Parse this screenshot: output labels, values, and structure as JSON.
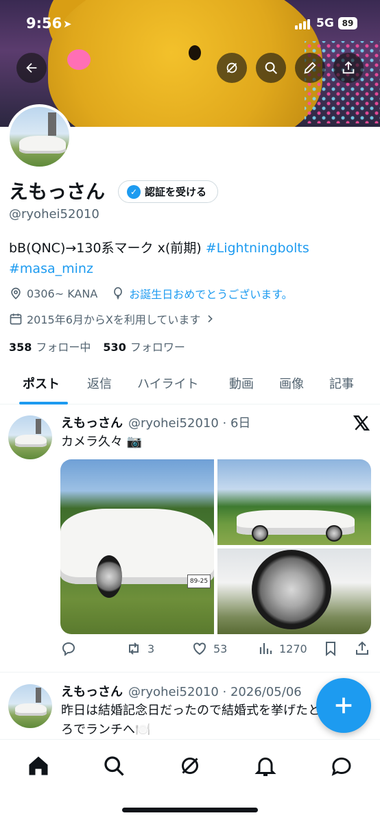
{
  "status_bar": {
    "time": "9:56",
    "network": "5G",
    "battery": "89"
  },
  "profile": {
    "name": "えもっさん",
    "verify_button": "認証を受ける",
    "handle": "@ryohei52010",
    "bio_text": "bB(QNC)→130系マーク x(前期) ",
    "bio_tag1": "#Lightningbolts",
    "bio_tag2": "#masa_minz",
    "location": "0306~  KANA",
    "birthday": "お誕生日おめでとうございます。",
    "joined": "2015年6月からXを利用しています",
    "following_count": "358",
    "following_label": "フォロー中",
    "followers_count": "530",
    "followers_label": "フォロワー"
  },
  "tabs": [
    "ポスト",
    "返信",
    "ハイライト",
    "動画",
    "画像",
    "記事"
  ],
  "posts": [
    {
      "name": "えもっさん",
      "meta": "@ryohei52010 · 6日",
      "text": "カメラ久々 📷",
      "plate": "89-25",
      "actions": {
        "retweets": "3",
        "likes": "53",
        "views": "1270"
      }
    },
    {
      "name": "えもっさん",
      "meta": "@ryohei52010 · 2026/05/06",
      "text_line1": "昨日は結婚記念日だったので結婚式を挙げたとこ",
      "text_line2": "ろでランチへ🍽️"
    }
  ],
  "colors": {
    "accent": "#1d9bf0",
    "text": "#0f1419",
    "muted": "#536471"
  },
  "icons": [
    "back-arrow-icon",
    "grok-icon",
    "search-icon",
    "edit-icon",
    "share-icon",
    "home-icon",
    "notifications-icon",
    "messages-icon"
  ]
}
